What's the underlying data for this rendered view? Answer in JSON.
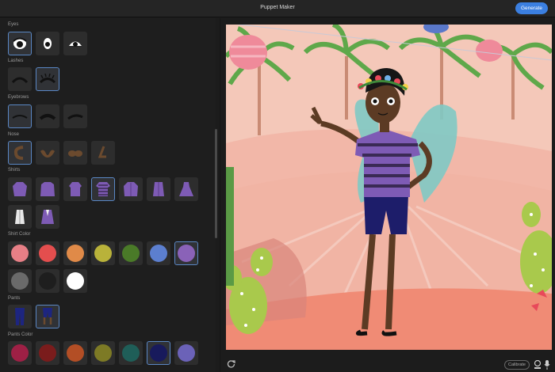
{
  "app": {
    "title": "Puppet Maker",
    "generate_label": "Generate"
  },
  "sections": {
    "eyes": "Eyes",
    "lashes": "Lashes",
    "eyebrows": "Eyebrows",
    "nose": "Nose",
    "shirts": "Shirts",
    "shirt_color": "Shirt Color",
    "pants": "Pants",
    "pants_color": "Pants Color"
  },
  "shirt_colors": [
    "#e77f86",
    "#e44e4e",
    "#e08a48",
    "#b9b23a",
    "#4a7a28",
    "#5c7fcf",
    "#8a62b8",
    "#6a6a6a",
    "#1e1e1e",
    "#ffffff"
  ],
  "pants_colors": [
    "#9e2045",
    "#7a1c1c",
    "#b34e25",
    "#7d7a25",
    "#1f5e58",
    "#181a5c",
    "#6b62b8"
  ],
  "accent": "#3b7fe0",
  "bottom": {
    "calibrate_label": "Calibrate"
  }
}
